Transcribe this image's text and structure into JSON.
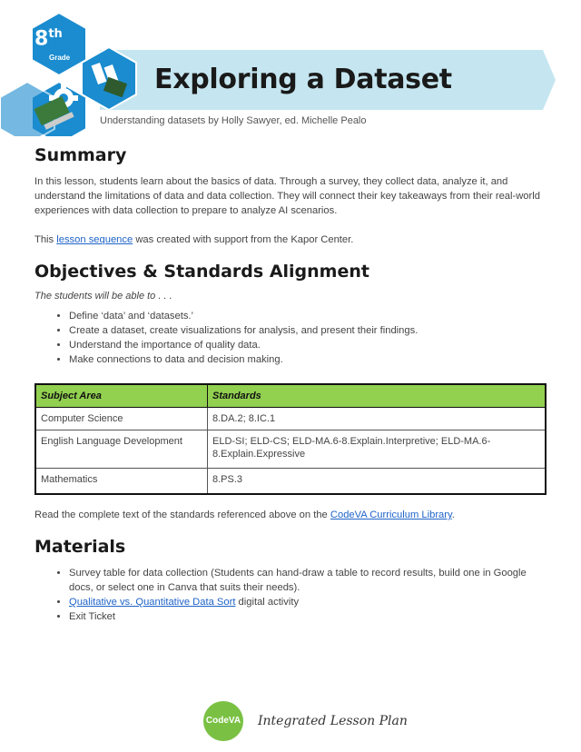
{
  "header": {
    "grade_number": "8",
    "grade_suffix": "th",
    "grade_word": "Grade",
    "title": "Exploring a Dataset",
    "subtitle": "Understanding datasets by Holly Sawyer, ed. Michelle Pealo",
    "banner_color": "#c5e6f0",
    "hex_color": "#1a8ccf"
  },
  "summary": {
    "heading": "Summary",
    "paragraph": "In this lesson, students learn about the basics of data. Through a survey, they collect data, analyze it, and understand the limitations of data and data collection. They will connect their key takeaways from their real-world experiences with data collection to prepare to analyze AI scenarios.",
    "credit_pre": "This ",
    "credit_link": "lesson sequence",
    "credit_post": " was created with support from the Kapor Center."
  },
  "objectives": {
    "heading": "Objectives & Standards Alignment",
    "intro": "The students will be able to . . .",
    "items": [
      "Define ‘data’ and ‘datasets.’",
      "Create a dataset, create visualizations for analysis, and present their findings.",
      "Understand the importance of quality data.",
      "Make connections to data and decision making."
    ]
  },
  "standards_table": {
    "headers": [
      "Subject Area",
      "Standards"
    ],
    "rows": [
      [
        "Computer Science",
        "8.DA.2; 8.IC.1"
      ],
      [
        "English Language Development",
        "ELD-SI; ELD-CS; ELD-MA.6-8.Explain.Interpretive; ELD-MA.6-8.Explain.Expressive"
      ],
      [
        "Mathematics",
        "8.PS.3"
      ]
    ],
    "header_color": "#92d050"
  },
  "standards_note": {
    "pre": "Read the complete text of the standards referenced above on the ",
    "link": "CodeVA Curriculum Library",
    "post": "."
  },
  "materials": {
    "heading": "Materials",
    "item1": "Survey table for data collection (Students can hand-draw a table to record results, build one in Google docs, or select one in Canva that suits their needs).",
    "item2_link": "Qualitative vs. Quantitative Data Sort",
    "item2_post": " digital activity",
    "item3": "Exit Ticket"
  },
  "footer": {
    "logo_text": "CodeVA",
    "label": "Integrated Lesson Plan",
    "logo_color": "#7ac143"
  },
  "link_color": "#1e63c8"
}
